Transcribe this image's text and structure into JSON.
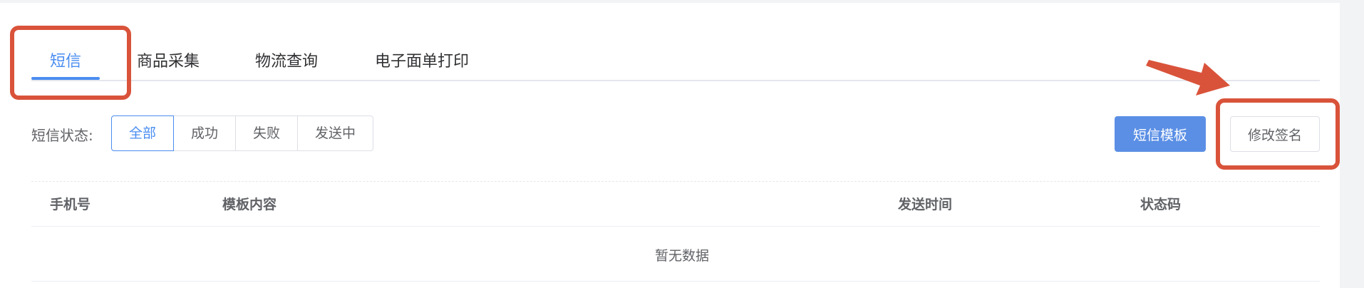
{
  "tabs": [
    {
      "label": "短信",
      "active": true
    },
    {
      "label": "商品采集",
      "active": false
    },
    {
      "label": "物流查询",
      "active": false
    },
    {
      "label": "电子面单打印",
      "active": false
    }
  ],
  "filter": {
    "label": "短信状态:",
    "options": [
      {
        "label": "全部",
        "active": true
      },
      {
        "label": "成功",
        "active": false
      },
      {
        "label": "失败",
        "active": false
      },
      {
        "label": "发送中",
        "active": false
      }
    ]
  },
  "actions": {
    "template_label": "短信模板",
    "signature_label": "修改签名"
  },
  "table": {
    "columns": [
      "手机号",
      "模板内容",
      "发送时间",
      "状态码"
    ],
    "empty_text": "暂无数据"
  },
  "colors": {
    "accent": "#4a8df0",
    "primary_button": "#5b8fe5",
    "annotation": "#d9533a"
  }
}
